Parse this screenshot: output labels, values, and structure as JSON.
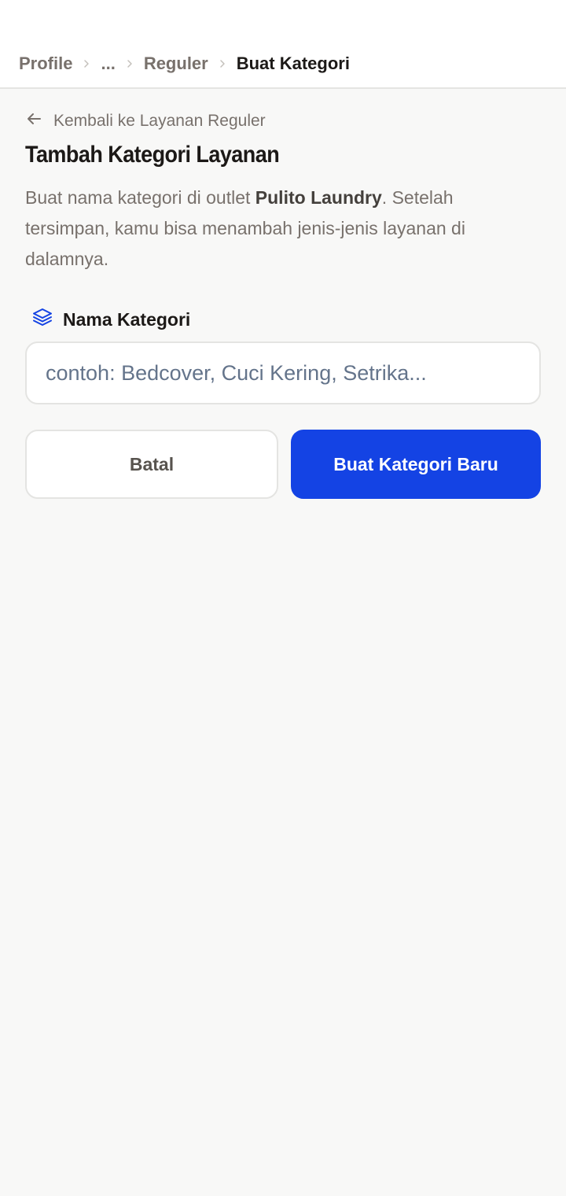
{
  "breadcrumb": {
    "items": [
      {
        "label": "Profile"
      },
      {
        "label": "..."
      },
      {
        "label": "Reguler"
      },
      {
        "label": "Buat Kategori"
      }
    ]
  },
  "back_link": {
    "label": "Kembali ke Layanan Reguler",
    "icon": "arrow-left-icon"
  },
  "page": {
    "title": "Tambah Kategori Layanan",
    "description_before": "Buat nama kategori di outlet ",
    "outlet_name": "Pulito Laundry",
    "description_after": ". Setelah tersimpan, kamu bisa menambah jenis-jenis layanan di dalamnya."
  },
  "form": {
    "label": "Nama Kategori",
    "label_icon": "layers-icon",
    "value": "",
    "placeholder": "contoh: Bedcover, Cuci Kering, Setrika..."
  },
  "actions": {
    "cancel_label": "Batal",
    "submit_label": "Buat Kategori Baru"
  },
  "colors": {
    "primary": "#1443e4",
    "background": "#f8f8f7",
    "muted_text": "#78716c"
  }
}
